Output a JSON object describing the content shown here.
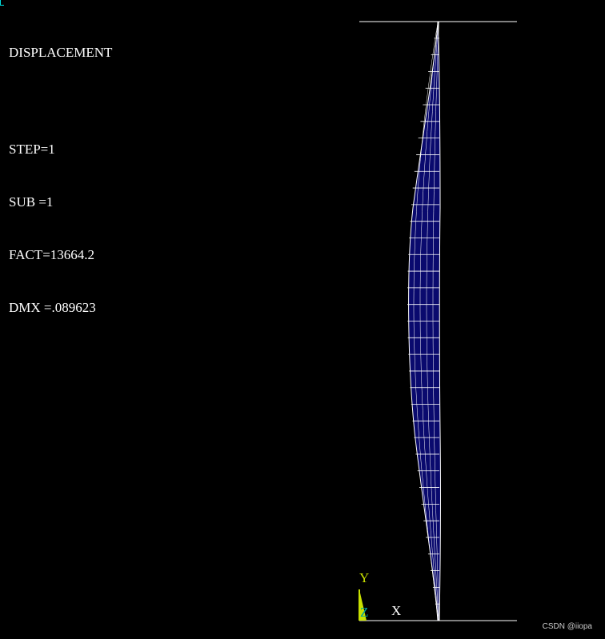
{
  "result_panel": {
    "title": "DISPLACEMENT",
    "step": "STEP=1",
    "sub": "SUB =1",
    "fact": "FACT=13664.2",
    "dmx": "DMX =.089623"
  },
  "triad": {
    "y_label": "Y",
    "x_label": "X",
    "z_label": "Z"
  },
  "watermark": "CSDN @iiopa",
  "colors": {
    "background": "#000000",
    "text": "#ffffff",
    "mesh_fill": "#0a0a6e",
    "mesh_line": "#ffffff",
    "triad_y": "#c8e000",
    "triad_x": "#ffffff",
    "triad_z": "#00a0a0",
    "corner_mark": "#00e0e0"
  }
}
